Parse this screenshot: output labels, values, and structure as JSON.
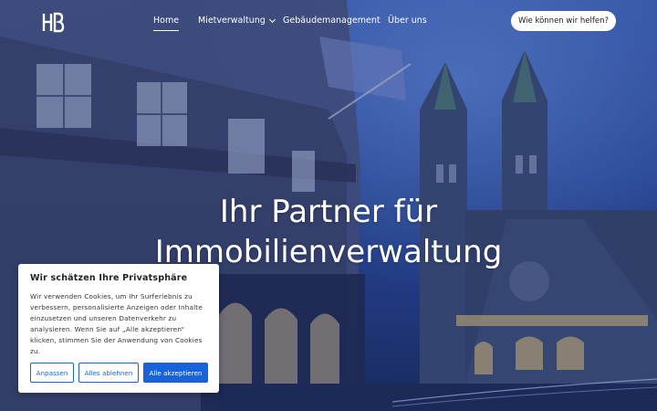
{
  "header": {
    "logo_text": "HB",
    "nav": [
      {
        "label": "Home",
        "active": true
      },
      {
        "label": "Mietverwaltung",
        "has_dropdown": true
      },
      {
        "label": "Gebäudemanagement"
      },
      {
        "label": "Über uns"
      }
    ],
    "cta_label": "Wie können wir helfen?"
  },
  "hero": {
    "headline_line1": "Ihr Partner für",
    "headline_line2": "Immobilienverwaltung"
  },
  "cookie_banner": {
    "title": "Wir schätzen Ihre Privatsphäre",
    "text": "Wir verwenden Cookies, um Ihr Surferlebnis zu verbessern, personalisierte Anzeigen oder Inhalte einzusetzen und unseren Datenverkehr zu analysieren. Wenn Sie auf „Alle akzeptieren“ klicken, stimmen Sie der Anwendung von Cookies zu.",
    "buttons": {
      "customize": "Anpassen",
      "reject": "Alles ablehnen",
      "accept": "Alle akzeptieren"
    },
    "accent_color": "#1863dc"
  },
  "icons": [
    "logo-icon",
    "chevron-down-icon"
  ]
}
